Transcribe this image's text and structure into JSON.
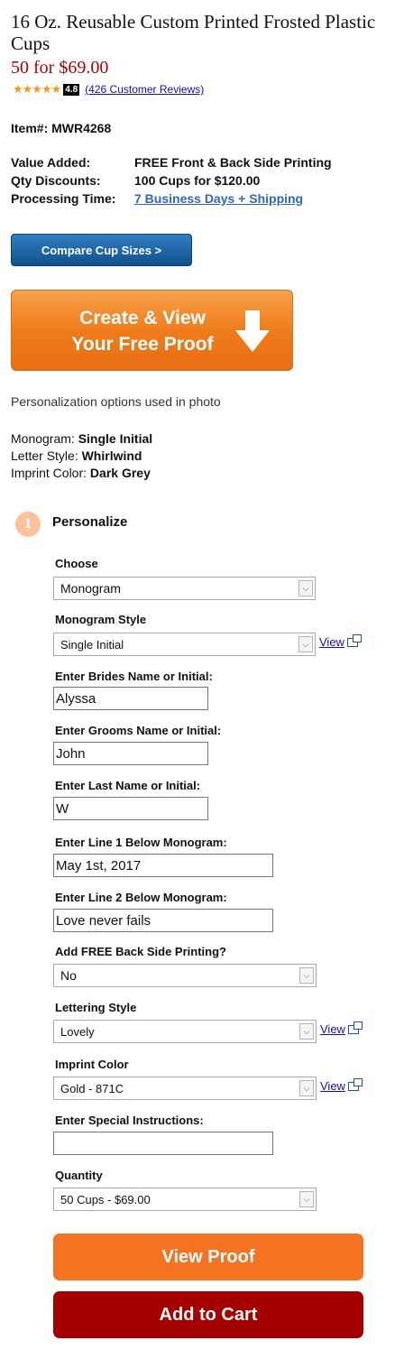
{
  "product": {
    "title": "16 Oz. Reusable Custom Printed Frosted Plastic Cups",
    "price": "50 for $69.00",
    "rating_value": "4.8",
    "rating_stars": 4.8,
    "reviews_link": "(426 Customer Reviews)",
    "item": "Item#: MWR4268"
  },
  "specs": [
    {
      "key": "Value Added:",
      "value": "FREE Front & Back Side Printing"
    },
    {
      "key": "Qty Discounts:",
      "value": "100 Cups for $120.00"
    },
    {
      "key": "Processing Time:",
      "value": "7 Business Days + Shipping"
    }
  ],
  "buttons": {
    "compare": "Compare Cup Sizes  >",
    "proof_line1": "Create & View",
    "proof_line2": "Your Free Proof",
    "view_proof": "View Proof",
    "add_to_cart": "Add to Cart"
  },
  "personalization_note": "Personalization options used in photo",
  "photo_options": [
    {
      "label": "Monogram:",
      "value": "Single Initial"
    },
    {
      "label": "Letter Style:",
      "value": "Whirlwind"
    },
    {
      "label": "Imprint Color:",
      "value": "Dark Grey"
    }
  ],
  "step": {
    "number": "1",
    "title": "Personalize"
  },
  "form": {
    "choose_label": "Choose",
    "choose_value": "Monogram",
    "monogram_style_label": "Monogram Style",
    "monogram_style_value": "Single Initial",
    "brides_label": "Enter Brides Name or Initial:",
    "brides_value": "Alyssa",
    "grooms_label": "Enter Grooms Name or Initial:",
    "grooms_value": "John",
    "last_label": "Enter Last Name or Initial:",
    "last_value": "W",
    "line1_label": "Enter Line 1 Below Monogram:",
    "line1_value": "May 1st, 2017",
    "line2_label": "Enter Line 2 Below Monogram:",
    "line2_value": "Love never fails",
    "backside_label": "Add FREE Back Side Printing?",
    "backside_value": "No",
    "lettering_label": "Lettering Style",
    "lettering_value": "Lovely",
    "imprint_label": "Imprint Color",
    "imprint_value": "Gold - 871C",
    "instructions_label": "Enter Special Instructions:",
    "instructions_value": "",
    "quantity_label": "Quantity",
    "quantity_value": "50 Cups - $69.00",
    "view_link": "View"
  }
}
